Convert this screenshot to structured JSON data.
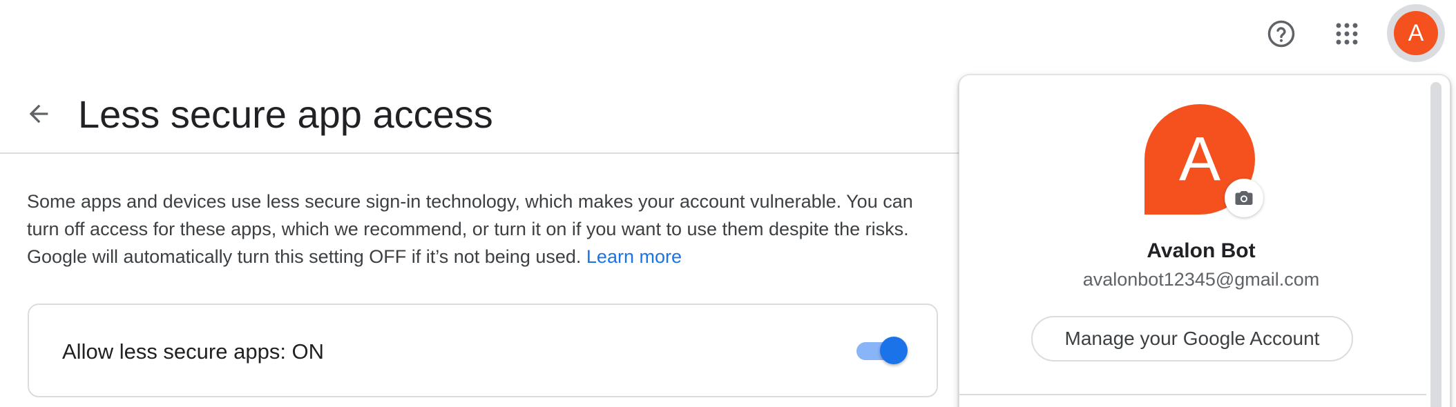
{
  "topbar": {
    "help_icon": "help-circle-icon",
    "apps_icon": "apps-grid-icon",
    "avatar_initial": "A",
    "avatar_color": "#f4511e"
  },
  "header": {
    "back_icon": "arrow-back-icon",
    "title": "Less secure app access"
  },
  "description": {
    "text": "Some apps and devices use less secure sign-in technology, which makes your account vulnerable. You can turn off access for these apps, which we recommend, or turn it on if you want to use them despite the risks. Google will automatically turn this setting OFF if it’s not being used.",
    "link_label": "Learn more"
  },
  "setting": {
    "label": "Allow less secure apps: ON",
    "toggle_on": true,
    "toggle_color": "#1a73e8"
  },
  "account_popup": {
    "avatar_initial": "A",
    "avatar_color": "#f4511e",
    "camera_icon": "camera-icon",
    "name": "Avalon Bot",
    "email": "avalonbot12345@gmail.com",
    "manage_label": "Manage your Google Account"
  }
}
